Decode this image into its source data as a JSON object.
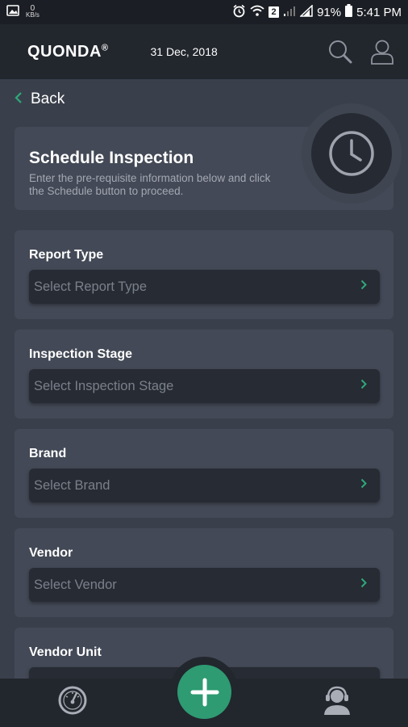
{
  "status_bar": {
    "speed_value": "0",
    "speed_unit": "KB/s",
    "sim_badge": "2",
    "battery": "91%",
    "time": "5:41 PM"
  },
  "header": {
    "logo": "QUONDA",
    "logo_mark": "®",
    "date": "31 Dec, 2018"
  },
  "back_label": "Back",
  "schedule": {
    "title": "Schedule Inspection",
    "description": "Enter the pre-requisite information below and click the Schedule button to proceed."
  },
  "fields": [
    {
      "label": "Report Type",
      "placeholder": "Select Report Type"
    },
    {
      "label": "Inspection Stage",
      "placeholder": "Select Inspection Stage"
    },
    {
      "label": "Brand",
      "placeholder": "Select Brand"
    },
    {
      "label": "Vendor",
      "placeholder": "Select Vendor"
    },
    {
      "label": "Vendor Unit",
      "placeholder": ""
    }
  ],
  "colors": {
    "accent": "#2e9b72",
    "background": "#3a404b",
    "card": "#434956",
    "header": "#22262d"
  }
}
